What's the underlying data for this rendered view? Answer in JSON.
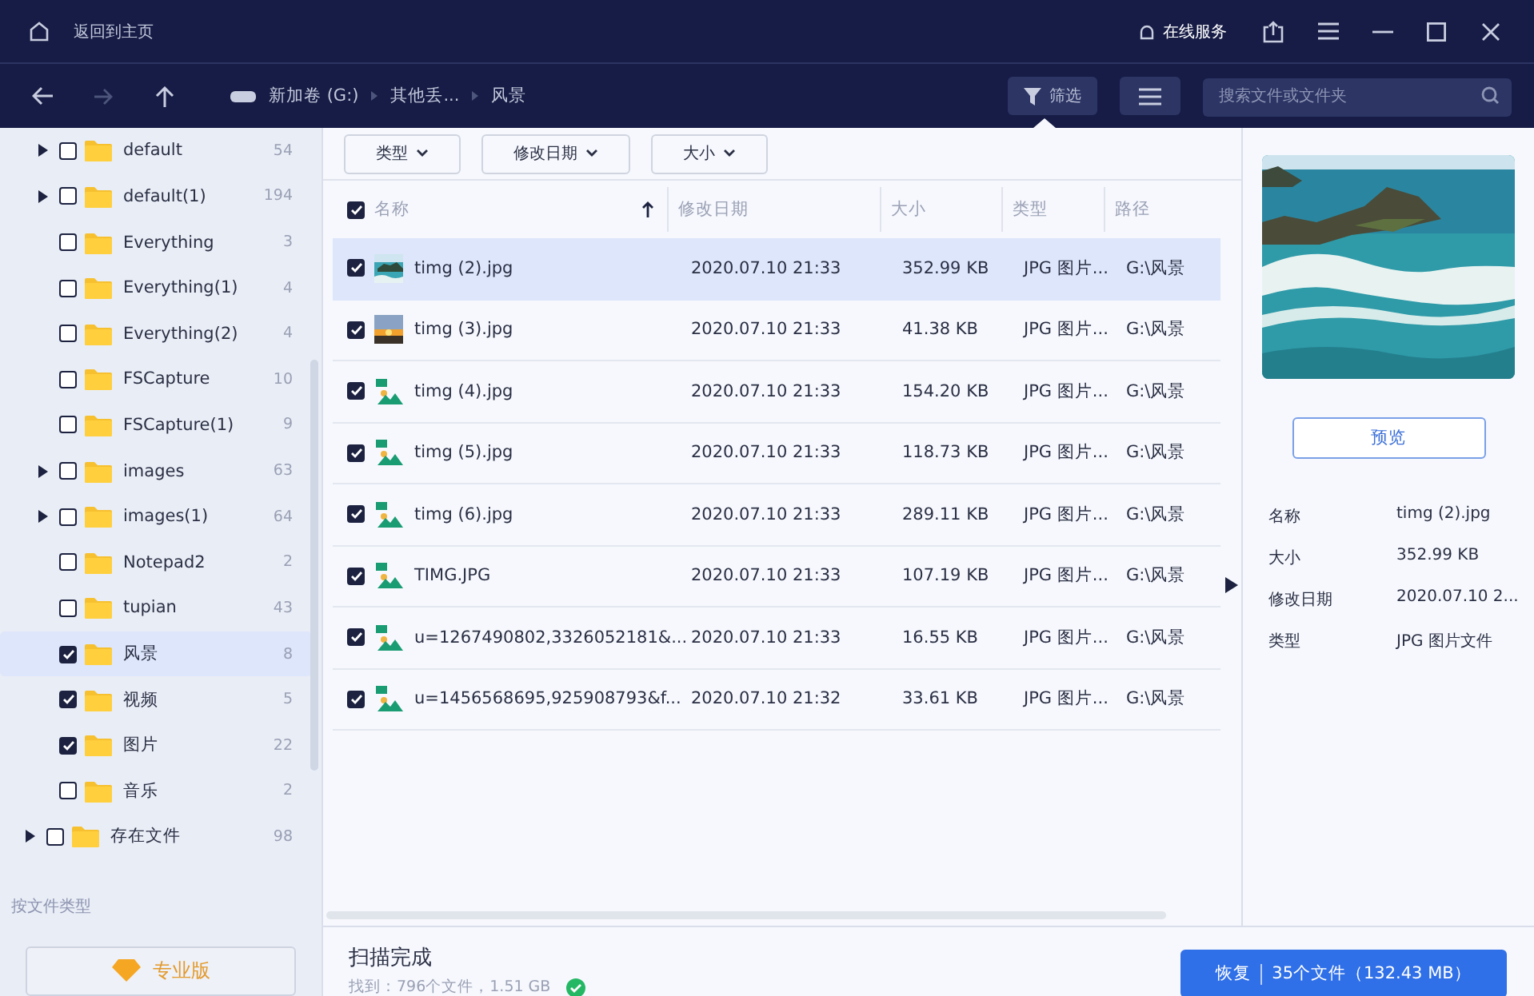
{
  "title_bar": {
    "home_label": "返回到主页",
    "service_label": "在线服务"
  },
  "nav": {
    "breadcrumb": [
      "新加卷 (G:)",
      "其他丢...",
      "风景"
    ],
    "filter_label": "筛选",
    "search": {
      "placeholder": "搜索文件或文件夹"
    }
  },
  "sidebar": {
    "tree": [
      {
        "children": [
          {
            "label": "default",
            "count": "54",
            "expandable": true,
            "checked": false,
            "selected": false
          },
          {
            "label": "default(1)",
            "count": "194",
            "expandable": true,
            "checked": false,
            "selected": false
          },
          {
            "label": "Everything",
            "count": "3",
            "expandable": false,
            "checked": false,
            "selected": false
          },
          {
            "label": "Everything(1)",
            "count": "4",
            "expandable": false,
            "checked": false,
            "selected": false
          },
          {
            "label": "Everything(2)",
            "count": "4",
            "expandable": false,
            "checked": false,
            "selected": false
          },
          {
            "label": "FSCapture",
            "count": "10",
            "expandable": false,
            "checked": false,
            "selected": false
          },
          {
            "label": "FSCapture(1)",
            "count": "9",
            "expandable": false,
            "checked": false,
            "selected": false
          },
          {
            "label": "images",
            "count": "63",
            "expandable": true,
            "checked": false,
            "selected": false
          },
          {
            "label": "images(1)",
            "count": "64",
            "expandable": true,
            "checked": false,
            "selected": false
          },
          {
            "label": "Notepad2",
            "count": "2",
            "expandable": false,
            "checked": false,
            "selected": false
          },
          {
            "label": "tupian",
            "count": "43",
            "expandable": false,
            "checked": false,
            "selected": false
          },
          {
            "label": "风景",
            "count": "8",
            "expandable": false,
            "checked": true,
            "selected": true
          },
          {
            "label": "视频",
            "count": "5",
            "expandable": false,
            "checked": true,
            "selected": false
          },
          {
            "label": "图片",
            "count": "22",
            "expandable": false,
            "checked": true,
            "selected": false
          },
          {
            "label": "音乐",
            "count": "2",
            "expandable": false,
            "checked": false,
            "selected": false
          }
        ]
      },
      {
        "label": "存在文件",
        "count": "98",
        "expandable": true,
        "checked": false,
        "selected": false
      }
    ],
    "section_label": "按文件类型",
    "pro_button": "专业版"
  },
  "filters": [
    "类型",
    "修改日期",
    "大小"
  ],
  "table": {
    "all_checked": true,
    "columns": [
      "名称",
      "修改日期",
      "大小",
      "类型",
      "路径"
    ],
    "rows": [
      {
        "name": "timg (2).jpg",
        "kind": "sea",
        "modified": "2020.07.10 21:33",
        "size": "352.99 KB",
        "type": "JPG 图片...",
        "path": "G:\\风景",
        "checked": true,
        "selected": true
      },
      {
        "name": "timg (3).jpg",
        "kind": "sunset",
        "modified": "2020.07.10 21:33",
        "size": "41.38 KB",
        "type": "JPG 图片...",
        "path": "G:\\风景",
        "checked": true,
        "selected": false
      },
      {
        "name": "timg (4).jpg",
        "kind": "icon",
        "modified": "2020.07.10 21:33",
        "size": "154.20 KB",
        "type": "JPG 图片...",
        "path": "G:\\风景",
        "checked": true,
        "selected": false
      },
      {
        "name": "timg (5).jpg",
        "kind": "icon",
        "modified": "2020.07.10 21:33",
        "size": "118.73 KB",
        "type": "JPG 图片...",
        "path": "G:\\风景",
        "checked": true,
        "selected": false
      },
      {
        "name": "timg (6).jpg",
        "kind": "icon",
        "modified": "2020.07.10 21:33",
        "size": "289.11 KB",
        "type": "JPG 图片...",
        "path": "G:\\风景",
        "checked": true,
        "selected": false
      },
      {
        "name": "TIMG.JPG",
        "kind": "icon",
        "modified": "2020.07.10 21:33",
        "size": "107.19 KB",
        "type": "JPG 图片...",
        "path": "G:\\风景",
        "checked": true,
        "selected": false
      },
      {
        "name": "u=1267490802,3326052181&...",
        "kind": "icon",
        "modified": "2020.07.10 21:33",
        "size": "16.55 KB",
        "type": "JPG 图片...",
        "path": "G:\\风景",
        "checked": true,
        "selected": false
      },
      {
        "name": "u=1456568695,925908793&f...",
        "kind": "icon",
        "modified": "2020.07.10 21:32",
        "size": "33.61 KB",
        "type": "JPG 图片...",
        "path": "G:\\风景",
        "checked": true,
        "selected": false
      }
    ]
  },
  "details": {
    "preview_button": "预览",
    "properties": [
      {
        "label": "名称",
        "value": "timg (2).jpg"
      },
      {
        "label": "大小",
        "value": "352.99 KB"
      },
      {
        "label": "修改日期",
        "value": "2020.07.10 2..."
      },
      {
        "label": "类型",
        "value": "JPG 图片文件"
      }
    ]
  },
  "status": {
    "title": "扫描完成",
    "summary": "找到：796个文件，1.51 GB",
    "recover_label": "恢复",
    "recover_count": "35个文件（132.43 MB）"
  }
}
